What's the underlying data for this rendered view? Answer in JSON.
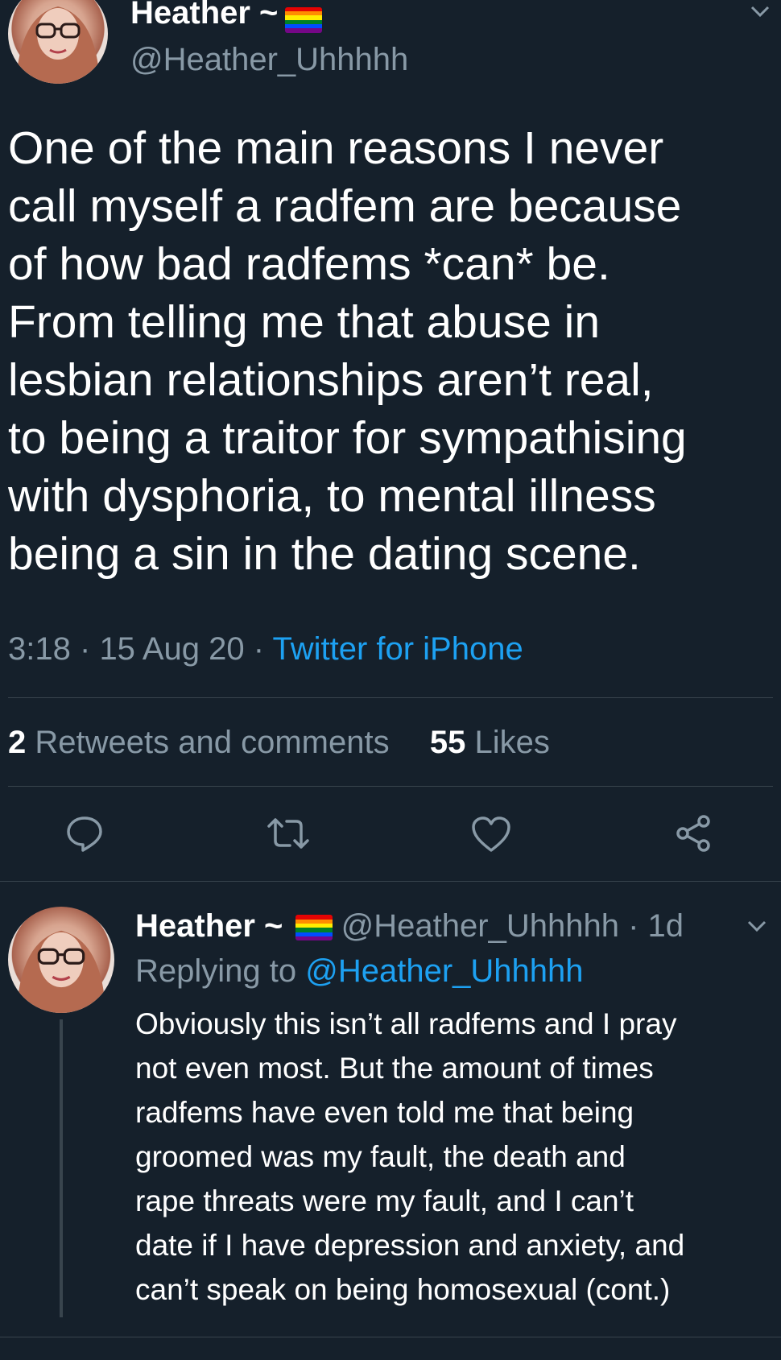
{
  "main_tweet": {
    "author_name": "Heather ~",
    "author_handle": "@Heather_Uhhhhh",
    "text_lines": [
      "One of the main reasons I never",
      "call myself a radfem are because",
      "of how bad radfems *can* be.",
      "From telling me that abuse in",
      "lesbian relationships aren’t real,",
      "to being a traitor for sympathising",
      "with dysphoria, to mental illness",
      "being a sin in the dating scene."
    ],
    "time": "3:18",
    "date": "15 Aug 20",
    "separator": "·",
    "source": "Twitter for iPhone",
    "retweets_count": "2",
    "retweets_label": "Retweets and comments",
    "likes_count": "55",
    "likes_label": "Likes"
  },
  "actions": {
    "reply_icon": "reply-icon",
    "retweet_icon": "retweet-icon",
    "like_icon": "heart-icon",
    "share_icon": "share-icon"
  },
  "reply_tweet": {
    "author_name": "Heather ~",
    "author_handle": "@Heather_Uhhhhh",
    "separator": "·",
    "time_ago": "1d",
    "replying_prefix": "Replying to",
    "replying_handle": "@Heather_Uhhhhh",
    "text_lines": [
      "Obviously this isn’t all radfems and I pray",
      "not even most. But the amount of times",
      "radfems have even told me that being",
      "groomed was my fault, the death and",
      "rape threats were my fault, and I can’t",
      "date if I have depression and anxiety, and",
      "can’t speak on being homosexual (cont.)"
    ]
  },
  "colors": {
    "background": "#15202b",
    "accent": "#1da1f2",
    "secondary_text": "#8899a6",
    "divider": "#38444d",
    "pride_flag": [
      "#e40303",
      "#ff8c00",
      "#ffed00",
      "#008026",
      "#004dff",
      "#750787"
    ]
  }
}
